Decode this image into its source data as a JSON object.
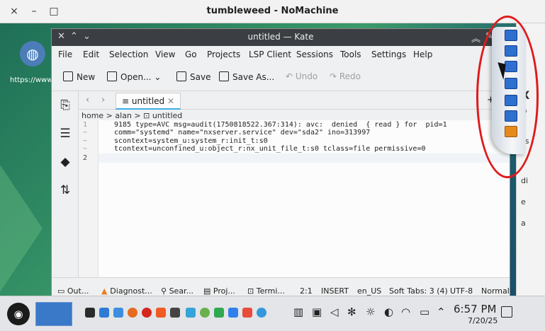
{
  "nomachine": {
    "title": "tumbleweed - NoMachine",
    "close_glyph": "×",
    "minimize_glyph": "–",
    "maximize_glyph": "□"
  },
  "desktop": {
    "icon_label": "https://www.linkedin.com",
    "right_panel": {
      "line1": "X",
      "line2": "D",
      "line3": "ss",
      "line4": "di",
      "line5": "e",
      "line6": "a"
    }
  },
  "kate": {
    "title": "untitled — Kate",
    "menu": [
      "File",
      "Edit",
      "Selection",
      "View",
      "Go",
      "Projects",
      "LSP Client",
      "Sessions",
      "Tools",
      "Settings",
      "Help"
    ],
    "toolbar": {
      "new": "New",
      "open": "Open...",
      "save": "Save",
      "save_as": "Save As...",
      "undo": "Undo",
      "redo": "Redo"
    },
    "tab_label": "untitled",
    "breadcrumb": "home > alan > ⊡ untitled",
    "lines": [
      {
        "num": "1",
        "text": "9185 type=AVC msg=audit(1750818522.367:314): avc:  denied  { read } for  pid=1"
      },
      {
        "num": "~",
        "text": "comm=\"systemd\" name=\"nxserver.service\" dev=\"sda2\" ino=313997"
      },
      {
        "num": "~",
        "text": "scontext=system_u:system_r:init_t:s0"
      },
      {
        "num": "~",
        "text": "tcontext=unconfined_u:object_r:nx_unit_file_t:s0 tclass=file permissive=0"
      },
      {
        "num": "2",
        "text": ""
      }
    ],
    "status": {
      "output": "Out...",
      "diagnostics": "Diagnost...",
      "search": "Sear...",
      "projects": "Proj...",
      "terminal": "Termi...",
      "position": "2:1",
      "mode": "INSERT",
      "language": "en_US",
      "indent": "Soft Tabs: 3 (4)",
      "encoding": "UTF-8",
      "view_mode": "Normal"
    }
  },
  "taskbar": {
    "time": "6:57 PM",
    "date": "7/20/25"
  },
  "colors": {
    "accent": "#3daee9",
    "highlight": "#e01a1a",
    "titlebar_dark": "#3b3f43"
  }
}
